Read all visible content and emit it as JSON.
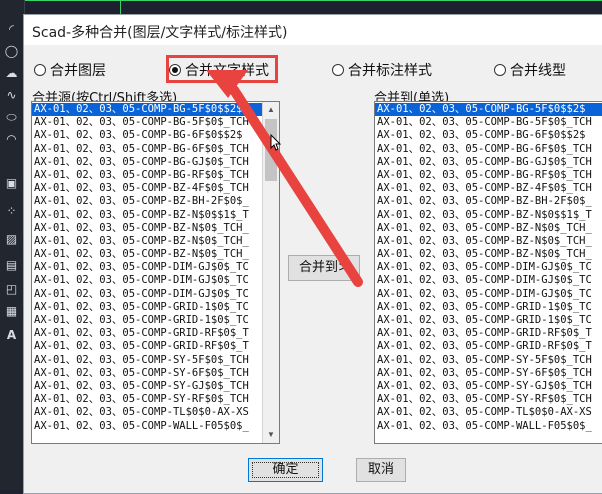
{
  "colors": {
    "accent_red": "#e8433e",
    "selection_blue": "#0a64d8",
    "cad_green": "#37d36a"
  },
  "dialog": {
    "title": "Scad-多种合并(图层/文字样式/标注样式)"
  },
  "radios": [
    {
      "label": "合并图层",
      "checked": false
    },
    {
      "label": "合并文字样式",
      "checked": true
    },
    {
      "label": "合并标注样式",
      "checked": false
    },
    {
      "label": "合并线型",
      "checked": false
    }
  ],
  "source": {
    "label": "合并源(按Ctrl/Shift多选)",
    "items": [
      "AX-01、02、03、05-COMP-BG-5F$0$$2$",
      "AX-01、02、03、05-COMP-BG-5F$0$_TCH",
      "AX-01、02、03、05-COMP-BG-6F$0$$2$",
      "AX-01、02、03、05-COMP-BG-6F$0$_TCH",
      "AX-01、02、03、05-COMP-BG-GJ$0$_TCH",
      "AX-01、02、03、05-COMP-BG-RF$0$_TCH",
      "AX-01、02、03、05-COMP-BZ-4F$0$_TCH",
      "AX-01、02、03、05-COMP-BZ-BH-2F$0$_",
      "AX-01、02、03、05-COMP-BZ-N$0$$1$_T",
      "AX-01、02、03、05-COMP-BZ-N$0$_TCH_",
      "AX-01、02、03、05-COMP-BZ-N$0$_TCH_",
      "AX-01、02、03、05-COMP-BZ-N$0$_TCH_",
      "AX-01、02、03、05-COMP-DIM-GJ$0$_TC",
      "AX-01、02、03、05-COMP-DIM-GJ$0$_TC",
      "AX-01、02、03、05-COMP-DIM-GJ$0$_TC",
      "AX-01、02、03、05-COMP-GRID-1$0$_TC",
      "AX-01、02、03、05-COMP-GRID-1$0$_TC",
      "AX-01、02、03、05-COMP-GRID-RF$0$_T",
      "AX-01、02、03、05-COMP-GRID-RF$0$_T",
      "AX-01、02、03、05-COMP-SY-5F$0$_TCH",
      "AX-01、02、03、05-COMP-SY-6F$0$_TCH",
      "AX-01、02、03、05-COMP-SY-GJ$0$_TCH",
      "AX-01、02、03、05-COMP-SY-RF$0$_TCH",
      "AX-01、02、03、05-COMP-TL$0$0-AX-XS",
      "AX-01、02、03、05-COMP-WALL-F05$0$_"
    ],
    "selected_index": 0,
    "scroll_fraction": 0.15
  },
  "target": {
    "label": "合并到(单选)",
    "items": [
      "AX-01、02、03、05-COMP-BG-5F$0$$2$",
      "AX-01、02、03、05-COMP-BG-5F$0$_TCH",
      "AX-01、02、03、05-COMP-BG-6F$0$$2$",
      "AX-01、02、03、05-COMP-BG-6F$0$_TCH",
      "AX-01、02、03、05-COMP-BG-GJ$0$_TCH",
      "AX-01、02、03、05-COMP-BG-RF$0$_TCH",
      "AX-01、02、03、05-COMP-BZ-4F$0$_TCH",
      "AX-01、02、03、05-COMP-BZ-BH-2F$0$_",
      "AX-01、02、03、05-COMP-BZ-N$0$$1$_T",
      "AX-01、02、03、05-COMP-BZ-N$0$_TCH_",
      "AX-01、02、03、05-COMP-BZ-N$0$_TCH_",
      "AX-01、02、03、05-COMP-BZ-N$0$_TCH_",
      "AX-01、02、03、05-COMP-DIM-GJ$0$_TC",
      "AX-01、02、03、05-COMP-DIM-GJ$0$_TC",
      "AX-01、02、03、05-COMP-DIM-GJ$0$_TC",
      "AX-01、02、03、05-COMP-GRID-1$0$_TC",
      "AX-01、02、03、05-COMP-GRID-1$0$_TC",
      "AX-01、02、03、05-COMP-GRID-RF$0$_T",
      "AX-01、02、03、05-COMP-GRID-RF$0$_T",
      "AX-01、02、03、05-COMP-SY-5F$0$_TCH",
      "AX-01、02、03、05-COMP-SY-6F$0$_TCH",
      "AX-01、02、03、05-COMP-SY-GJ$0$_TCH",
      "AX-01、02、03、05-COMP-SY-RF$0$_TCH",
      "AX-01、02、03、05-COMP-TL$0$0-AX-XS",
      "AX-01、02、03、05-COMP-WALL-F05$0$_"
    ],
    "selected_index": 0
  },
  "buttons": {
    "merge_to": "合并到>",
    "ok": "确定",
    "cancel": "取消"
  },
  "icons": [
    "arc-icon",
    "circle-icon",
    "cloud-icon",
    "spline-icon",
    "ellipse-icon",
    "block-icon",
    "point-icon",
    "hatch-icon",
    "gradient-icon",
    "region-icon",
    "table-icon",
    "text-icon"
  ]
}
